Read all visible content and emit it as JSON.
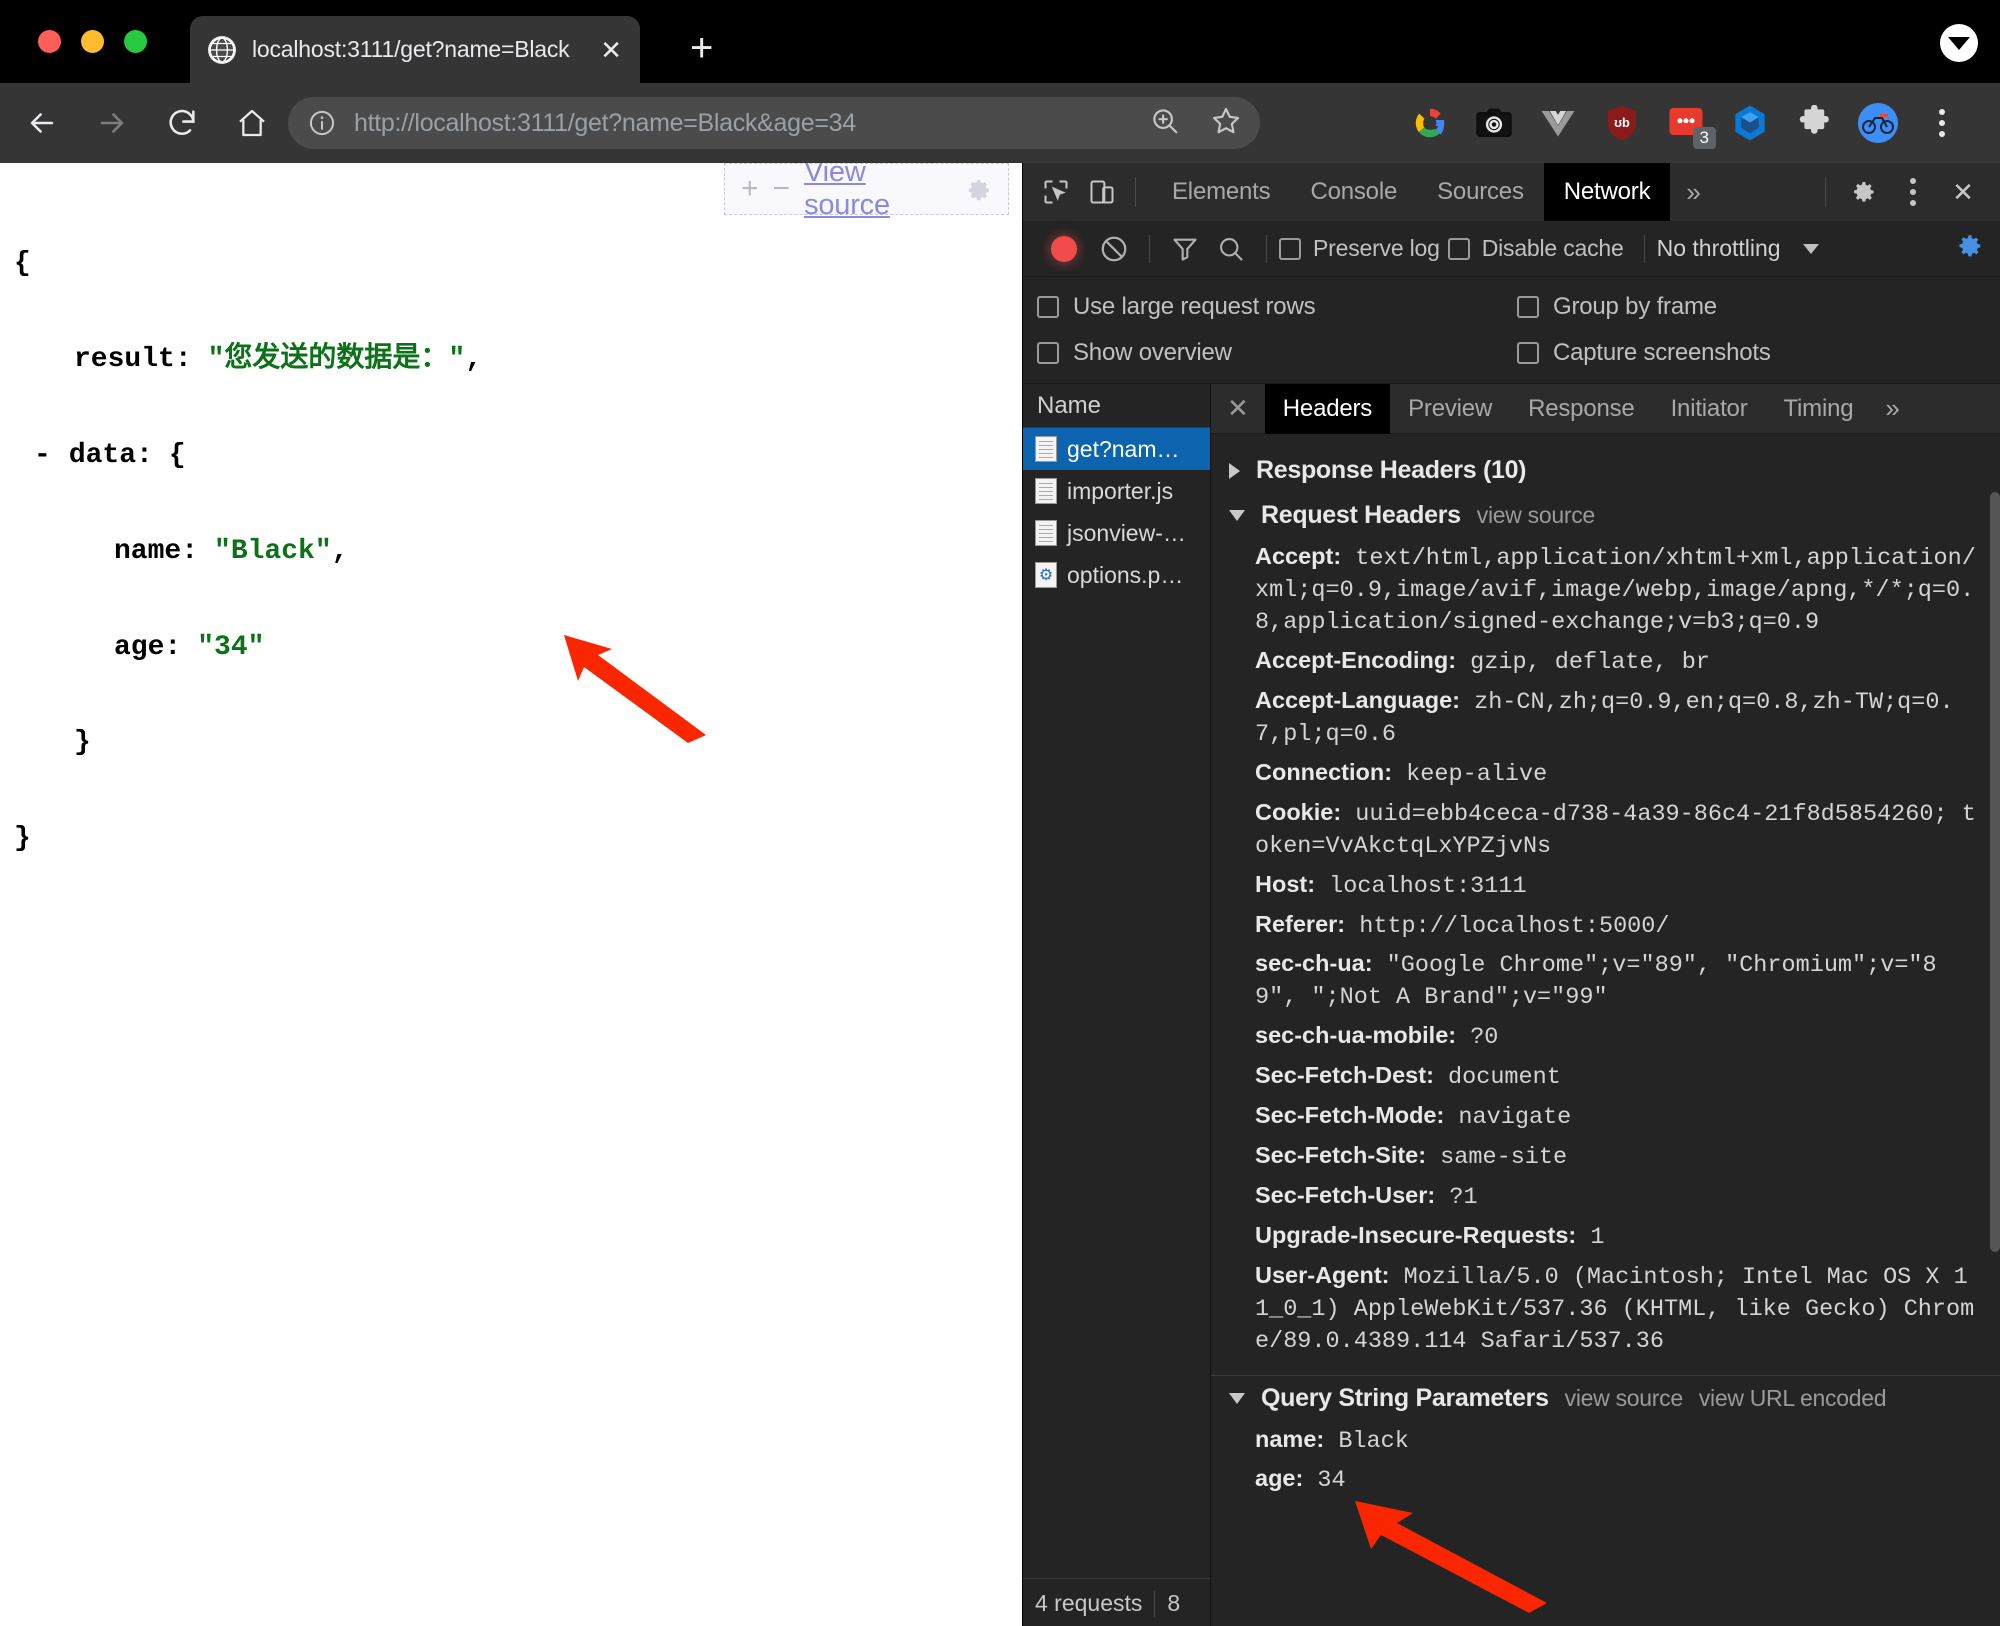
{
  "browser": {
    "tab": {
      "title": "localhost:3111/get?name=Black",
      "favicon": "globe-icon",
      "close_label": "✕"
    },
    "new_tab_label": "+",
    "window_menu_icon": "chevron-down-circle-icon",
    "nav": {
      "back": "back-arrow-icon",
      "forward": "forward-arrow-icon",
      "reload": "reload-icon",
      "home": "home-icon"
    },
    "omnibox": {
      "info_icon": "info-circle-icon",
      "url_scheme": "http://",
      "url_host": "localhost:3111",
      "url_path": "/get?name=Black&age=34",
      "url_full": "http://localhost:3111/get?name=Black&age=34",
      "zoom_icon": "zoom-in-icon",
      "bookmark_icon": "star-icon"
    },
    "extensions": [
      {
        "name": "google-extension-icon",
        "badge": ""
      },
      {
        "name": "screenshot-camera-icon",
        "badge": ""
      },
      {
        "name": "vue-devtools-icon",
        "badge": ""
      },
      {
        "name": "ublock-origin-shield-icon",
        "badge": ""
      },
      {
        "name": "red-notes-extension-icon",
        "badge": "3"
      },
      {
        "name": "blue-cube-extension-icon",
        "badge": ""
      },
      {
        "name": "puzzle-extensions-icon",
        "badge": ""
      },
      {
        "name": "profile-avatar-bicycle-icon",
        "badge": ""
      }
    ],
    "menu_icon": "kebab-menu-icon"
  },
  "page": {
    "viewsource_panel": {
      "expand_label": "+",
      "collapse_label": "−",
      "link_label": "View source",
      "gear_icon": "gear-icon"
    },
    "json": {
      "open_brace": "{",
      "line_result_key": "result:",
      "line_result_value": "\"您发送的数据是：\"",
      "line_result_comma": ",",
      "collapse_marker": "-",
      "line_data_key": "data:",
      "line_data_open": "{",
      "line_name_key": "name:",
      "line_name_value": "\"Black\"",
      "line_name_comma": ",",
      "line_age_key": "age:",
      "line_age_value": "\"34\"",
      "inner_close_brace": "}",
      "close_brace": "}"
    },
    "annotation_arrow": "red-arrow-annotation"
  },
  "devtools": {
    "header": {
      "inspect_icon": "inspect-element-icon",
      "device_icon": "device-toolbar-icon",
      "tabs": [
        {
          "label": "Elements",
          "active": false
        },
        {
          "label": "Console",
          "active": false
        },
        {
          "label": "Sources",
          "active": false
        },
        {
          "label": "Network",
          "active": true
        }
      ],
      "more_tabs_label": "»",
      "settings_icon": "gear-icon",
      "kebab_icon": "kebab-menu-icon",
      "close_label": "✕"
    },
    "network_toolbar": {
      "record_icon": "record-stop-icon",
      "clear_icon": "clear-icon",
      "filter_icon": "filter-icon",
      "search_icon": "search-icon",
      "preserve_log_label": "Preserve log",
      "preserve_log_checked": false,
      "disable_cache_label": "Disable cache",
      "disable_cache_checked": false,
      "throttling_value": "No throttling",
      "throttle_caret": "chevron-down-icon",
      "network_settings_icon": "gear-icon"
    },
    "options": [
      {
        "label": "Use large request rows",
        "checked": false
      },
      {
        "label": "Group by frame",
        "checked": false
      },
      {
        "label": "Show overview",
        "checked": false
      },
      {
        "label": "Capture screenshots",
        "checked": false
      }
    ],
    "request_list": {
      "column_header": "Name",
      "rows": [
        {
          "name": "get?nam…",
          "icon": "document-icon",
          "selected": true
        },
        {
          "name": "importer.js",
          "icon": "document-icon",
          "selected": false
        },
        {
          "name": "jsonview-…",
          "icon": "document-icon",
          "selected": false
        },
        {
          "name": "options.p…",
          "icon": "gear-document-icon",
          "selected": false
        }
      ],
      "footer_requests": "4 requests",
      "footer_transferred": "8"
    },
    "detail": {
      "close_label": "✕",
      "tabs": [
        {
          "label": "Headers",
          "active": true
        },
        {
          "label": "Preview",
          "active": false
        },
        {
          "label": "Response",
          "active": false
        },
        {
          "label": "Initiator",
          "active": false
        },
        {
          "label": "Timing",
          "active": false
        }
      ],
      "more_label": "»",
      "response_headers_title": "Response Headers (10)",
      "response_headers_expanded": false,
      "request_headers_title": "Request Headers",
      "request_headers_expanded": true,
      "request_headers_view_source": "view source",
      "request_headers": [
        {
          "name": "Accept:",
          "value": " text/html,application/xhtml+xml,application/xml;q=0.9,image/avif,image/webp,image/apng,*/*;q=0.8,application/signed-exchange;v=b3;q=0.9"
        },
        {
          "name": "Accept-Encoding:",
          "value": " gzip, deflate, br"
        },
        {
          "name": "Accept-Language:",
          "value": " zh-CN,zh;q=0.9,en;q=0.8,zh-TW;q=0.7,pl;q=0.6"
        },
        {
          "name": "Connection:",
          "value": " keep-alive"
        },
        {
          "name": "Cookie:",
          "value": " uuid=ebb4ceca-d738-4a39-86c4-21f8d5854260; token=VvAkctqLxYPZjvNs"
        },
        {
          "name": "Host:",
          "value": " localhost:3111"
        },
        {
          "name": "Referer:",
          "value": " http://localhost:5000/"
        },
        {
          "name": "sec-ch-ua:",
          "value": " \"Google Chrome\";v=\"89\", \"Chromium\";v=\"89\", \";Not A Brand\";v=\"99\""
        },
        {
          "name": "sec-ch-ua-mobile:",
          "value": " ?0"
        },
        {
          "name": "Sec-Fetch-Dest:",
          "value": " document"
        },
        {
          "name": "Sec-Fetch-Mode:",
          "value": " navigate"
        },
        {
          "name": "Sec-Fetch-Site:",
          "value": " same-site"
        },
        {
          "name": "Sec-Fetch-User:",
          "value": " ?1"
        },
        {
          "name": "Upgrade-Insecure-Requests:",
          "value": " 1"
        },
        {
          "name": "User-Agent:",
          "value": " Mozilla/5.0 (Macintosh; Intel Mac OS X 11_0_1) AppleWebKit/537.36 (KHTML, like Gecko) Chrome/89.0.4389.114 Safari/537.36"
        }
      ],
      "query_string_title": "Query String Parameters",
      "query_string_expanded": true,
      "query_view_source": "view source",
      "query_view_url_encoded": "view URL encoded",
      "query_params": [
        {
          "name": "name:",
          "value": " Black"
        },
        {
          "name": "age:",
          "value": " 34"
        }
      ],
      "annotation_arrow": "red-arrow-annotation"
    }
  },
  "colors": {
    "chrome_toolbar": "#353535",
    "devtools_bg": "#242424",
    "selection_blue": "#0b64ad",
    "json_string_green": "#0b7218",
    "annotation_red": "#fa2600",
    "record_red": "#f14c4c",
    "accent_blue": "#4a90e2"
  }
}
